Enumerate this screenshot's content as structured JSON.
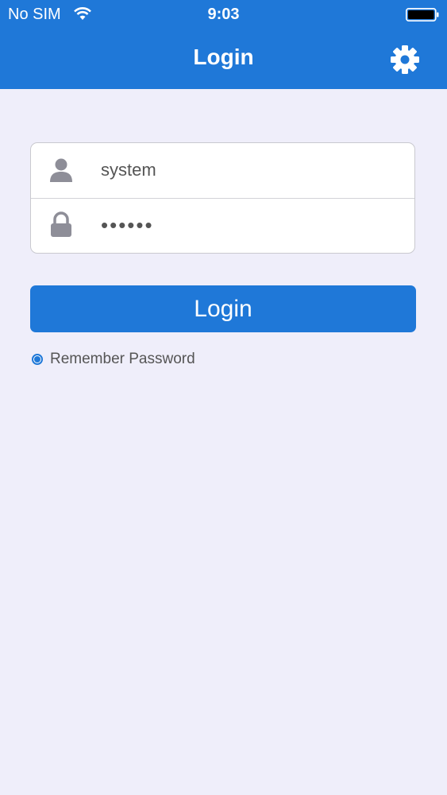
{
  "status_bar": {
    "carrier": "No SIM",
    "time": "9:03"
  },
  "nav": {
    "title": "Login",
    "settings_icon": "gear-icon"
  },
  "form": {
    "username": {
      "value": "system",
      "icon": "user-icon"
    },
    "password": {
      "value": "••••••",
      "icon": "lock-icon"
    }
  },
  "actions": {
    "login_label": "Login",
    "remember_label": "Remember Password",
    "remember_checked": true
  },
  "colors": {
    "accent": "#1f78d8",
    "background": "#efeefa",
    "icon_gray": "#8e8e98"
  }
}
